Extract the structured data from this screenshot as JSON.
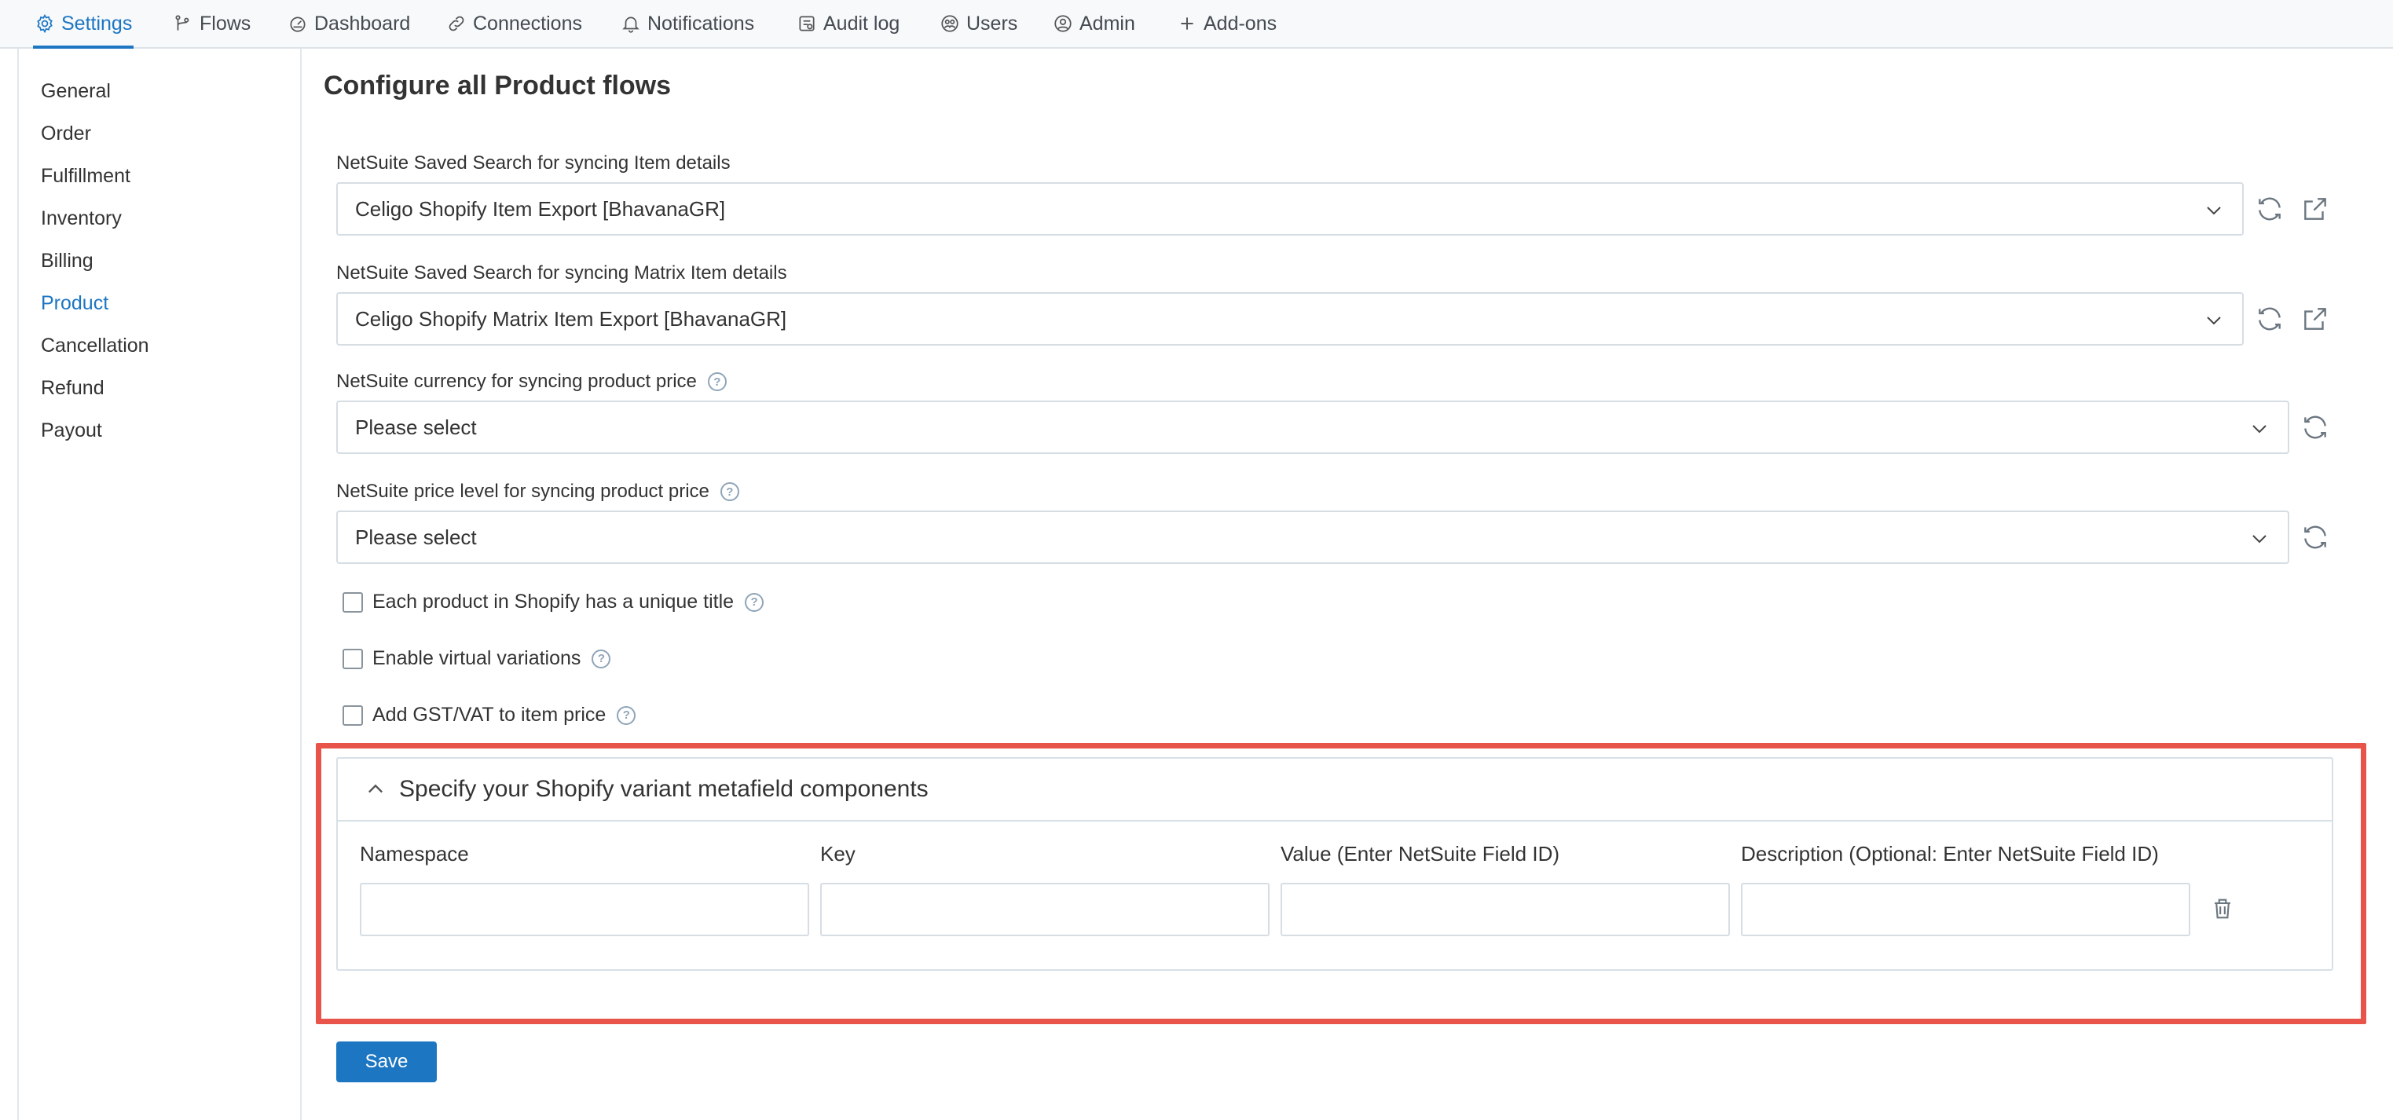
{
  "nav": {
    "tabs": [
      {
        "label": "Settings",
        "icon": "gear-icon"
      },
      {
        "label": "Flows",
        "icon": "flow-icon"
      },
      {
        "label": "Dashboard",
        "icon": "gauge-icon"
      },
      {
        "label": "Connections",
        "icon": "link-icon"
      },
      {
        "label": "Notifications",
        "icon": "bell-icon"
      },
      {
        "label": "Audit log",
        "icon": "audit-log-icon"
      },
      {
        "label": "Users",
        "icon": "users-icon"
      },
      {
        "label": "Admin",
        "icon": "user-circle-icon"
      },
      {
        "label": "Add-ons",
        "icon": "plus-icon"
      }
    ],
    "active_tab": "Settings"
  },
  "sidebar": {
    "items": [
      {
        "label": "General"
      },
      {
        "label": "Order"
      },
      {
        "label": "Fulfillment"
      },
      {
        "label": "Inventory"
      },
      {
        "label": "Billing"
      },
      {
        "label": "Product"
      },
      {
        "label": "Cancellation"
      },
      {
        "label": "Refund"
      },
      {
        "label": "Payout"
      }
    ],
    "active_item": "Product"
  },
  "main": {
    "title": "Configure all Product flows",
    "fields": [
      {
        "label": "NetSuite Saved Search for syncing Item details",
        "value": "Celigo Shopify Item Export [BhavanaGR]"
      },
      {
        "label": "NetSuite Saved Search for syncing Matrix Item details",
        "value": "Celigo Shopify Matrix Item Export [BhavanaGR]"
      },
      {
        "label": "NetSuite currency for syncing product price",
        "value": "Please select"
      },
      {
        "label": "NetSuite price level for syncing product price",
        "value": "Please select"
      }
    ],
    "checkboxes": [
      {
        "label": "Each product in Shopify has a unique title",
        "checked": false
      },
      {
        "label": "Enable virtual variations",
        "checked": false
      },
      {
        "label": "Add GST/VAT to item price",
        "checked": false
      }
    ],
    "help_glyph": "?",
    "metafield_panel": {
      "title": "Specify your Shopify variant metafield components",
      "expanded": true,
      "columns": [
        {
          "label": "Namespace",
          "value": ""
        },
        {
          "label": "Key",
          "value": ""
        },
        {
          "label": "Value (Enter NetSuite Field ID)",
          "value": ""
        },
        {
          "label": "Description (Optional: Enter NetSuite Field ID)",
          "value": ""
        }
      ]
    },
    "save_label": "Save"
  },
  "colors": {
    "accent": "#1d76c2",
    "highlight": "#e8544a"
  }
}
